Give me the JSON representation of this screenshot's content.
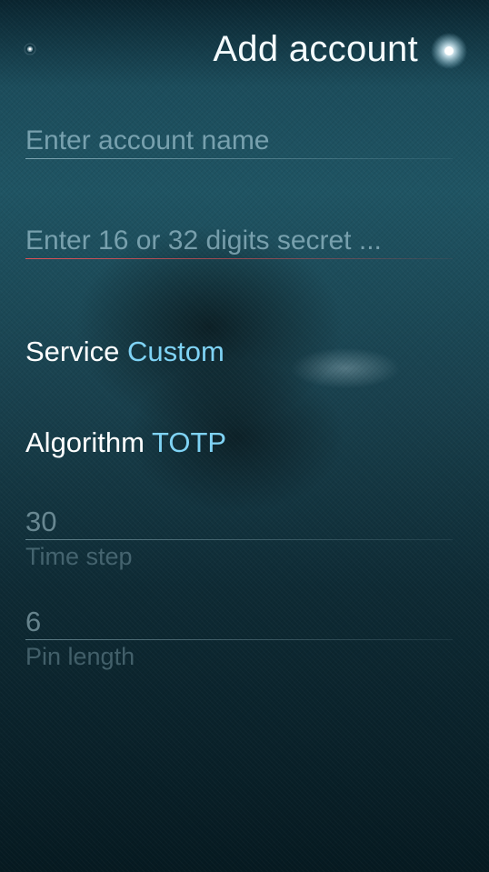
{
  "header": {
    "title": "Add account"
  },
  "form": {
    "account_name": {
      "value": "",
      "placeholder": "Enter account name"
    },
    "secret": {
      "value": "",
      "placeholder": "Enter 16 or 32 digits secret ..."
    },
    "service": {
      "label": "Service",
      "value": "Custom"
    },
    "algorithm": {
      "label": "Algorithm",
      "value": "TOTP"
    },
    "time_step": {
      "value": "30",
      "description": "Time step"
    },
    "pin_length": {
      "value": "6",
      "description": "Pin length"
    }
  },
  "colors": {
    "accent": "#7fd3f5",
    "primary_text": "#ffffff",
    "error_underline": "#eb5055"
  },
  "icons": {
    "left": "pulley-back-indicator-icon",
    "right": "accept-glow-icon"
  }
}
